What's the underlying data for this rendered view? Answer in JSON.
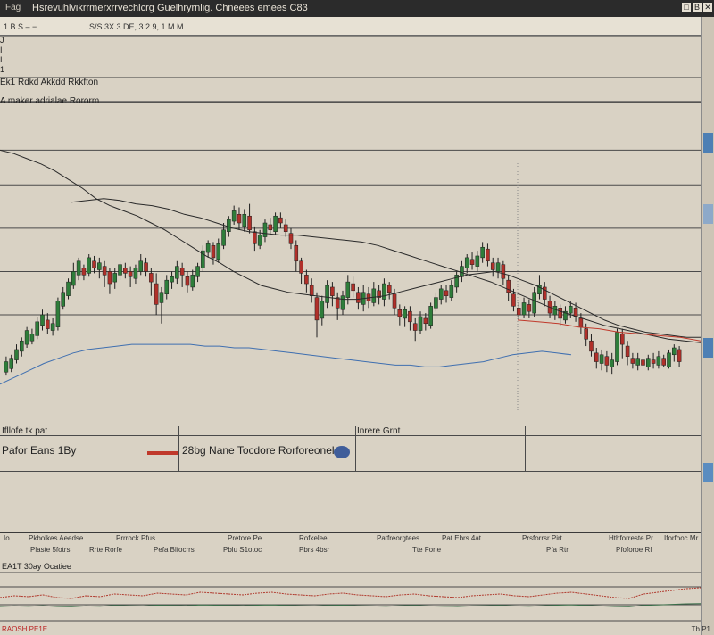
{
  "window": {
    "title": "Hsrevuhlvikrrmerxrrvechlcrg Guelhryrnlig. Chneees emees C83",
    "icon_label": "Fag",
    "buttons": [
      "□",
      "B",
      "✕"
    ]
  },
  "subbar": {
    "label": "1 B S – −",
    "info": "S/S 3X 3 DE, 3 2 9, 1 M M"
  },
  "side_markers": [
    "J",
    "I",
    "I",
    "1"
  ],
  "pane1": {
    "header": "Ek1 Rdkd Akkdd Rkkfton"
  },
  "pane2": {
    "header": "A maker adrialae Rororm"
  },
  "chart_data": {
    "type": "candlestick",
    "candles": [
      [
        22,
        28,
        31,
        20
      ],
      [
        24,
        30,
        32,
        22
      ],
      [
        29,
        35,
        38,
        27
      ],
      [
        34,
        40,
        42,
        31
      ],
      [
        38,
        46,
        48,
        36
      ],
      [
        40,
        44,
        47,
        38
      ],
      [
        43,
        51,
        54,
        41
      ],
      [
        49,
        55,
        58,
        46
      ],
      [
        52,
        47,
        56,
        44
      ],
      [
        46,
        50,
        53,
        43
      ],
      [
        48,
        63,
        65,
        46
      ],
      [
        60,
        68,
        71,
        58
      ],
      [
        66,
        74,
        76,
        64
      ],
      [
        72,
        80,
        85,
        70
      ],
      [
        78,
        86,
        88,
        75
      ],
      [
        82,
        78,
        84,
        75
      ],
      [
        79,
        88,
        90,
        77
      ],
      [
        86,
        82,
        89,
        79
      ],
      [
        81,
        85,
        88,
        76
      ],
      [
        83,
        78,
        86,
        71
      ],
      [
        80,
        73,
        82,
        67
      ],
      [
        74,
        79,
        82,
        70
      ],
      [
        78,
        84,
        86,
        75
      ],
      [
        82,
        79,
        85,
        76
      ],
      [
        80,
        77,
        83,
        71
      ],
      [
        76,
        82,
        84,
        73
      ],
      [
        80,
        86,
        90,
        78
      ],
      [
        85,
        80,
        88,
        77
      ],
      [
        79,
        74,
        82,
        66
      ],
      [
        73,
        61,
        79,
        55
      ],
      [
        62,
        68,
        71,
        50
      ],
      [
        67,
        75,
        78,
        64
      ],
      [
        74,
        77,
        80,
        70
      ],
      [
        76,
        83,
        86,
        73
      ],
      [
        82,
        78,
        85,
        71
      ],
      [
        77,
        72,
        80,
        68
      ],
      [
        71,
        78,
        81,
        69
      ],
      [
        77,
        83,
        85,
        74
      ],
      [
        82,
        92,
        95,
        80
      ],
      [
        91,
        96,
        98,
        88
      ],
      [
        95,
        88,
        97,
        84
      ],
      [
        87,
        96,
        99,
        85
      ],
      [
        95,
        104,
        108,
        93
      ],
      [
        103,
        110,
        112,
        100
      ],
      [
        109,
        115,
        118,
        107
      ],
      [
        113,
        108,
        117,
        104
      ],
      [
        106,
        113,
        116,
        103
      ],
      [
        112,
        104,
        119,
        102
      ],
      [
        103,
        96,
        106,
        92
      ],
      [
        95,
        101,
        104,
        93
      ],
      [
        100,
        108,
        110,
        97
      ],
      [
        107,
        104,
        111,
        101
      ],
      [
        103,
        112,
        114,
        101
      ],
      [
        111,
        108,
        114,
        105
      ],
      [
        107,
        103,
        110,
        100
      ],
      [
        102,
        96,
        105,
        93
      ],
      [
        95,
        86,
        98,
        80
      ],
      [
        86,
        79,
        88,
        73
      ],
      [
        78,
        73,
        81,
        68
      ],
      [
        72,
        66,
        76,
        62
      ],
      [
        65,
        52,
        68,
        42
      ],
      [
        53,
        63,
        66,
        49
      ],
      [
        62,
        72,
        75,
        59
      ],
      [
        71,
        66,
        74,
        60
      ],
      [
        65,
        59,
        68,
        52
      ],
      [
        58,
        66,
        69,
        55
      ],
      [
        65,
        74,
        78,
        61
      ],
      [
        73,
        69,
        77,
        65
      ],
      [
        68,
        62,
        71,
        58
      ],
      [
        61,
        68,
        72,
        57
      ],
      [
        67,
        63,
        71,
        59
      ],
      [
        62,
        70,
        74,
        60
      ],
      [
        69,
        65,
        72,
        61
      ],
      [
        64,
        73,
        76,
        60
      ],
      [
        72,
        68,
        74,
        64
      ],
      [
        67,
        59,
        70,
        55
      ],
      [
        58,
        54,
        61,
        49
      ],
      [
        53,
        58,
        60,
        48
      ],
      [
        57,
        51,
        60,
        46
      ],
      [
        50,
        46,
        53,
        40
      ],
      [
        46,
        54,
        57,
        44
      ],
      [
        53,
        50,
        56,
        46
      ],
      [
        49,
        60,
        62,
        47
      ],
      [
        59,
        65,
        68,
        57
      ],
      [
        64,
        70,
        72,
        61
      ],
      [
        69,
        66,
        72,
        62
      ],
      [
        65,
        72,
        75,
        63
      ],
      [
        71,
        78,
        80,
        68
      ],
      [
        77,
        83,
        86,
        74
      ],
      [
        82,
        88,
        90,
        79
      ],
      [
        87,
        84,
        91,
        81
      ],
      [
        83,
        89,
        92,
        80
      ],
      [
        88,
        94,
        97,
        85
      ],
      [
        93,
        86,
        96,
        83
      ],
      [
        85,
        81,
        88,
        77
      ],
      [
        80,
        85,
        88,
        76
      ],
      [
        84,
        76,
        86,
        72
      ],
      [
        75,
        68,
        78,
        63
      ],
      [
        67,
        60,
        70,
        57
      ],
      [
        59,
        55,
        62,
        52
      ],
      [
        55,
        62,
        65,
        53
      ],
      [
        61,
        57,
        64,
        53
      ],
      [
        56,
        68,
        71,
        54
      ],
      [
        67,
        72,
        78,
        64
      ],
      [
        71,
        64,
        74,
        60
      ],
      [
        63,
        56,
        66,
        53
      ],
      [
        55,
        60,
        63,
        52
      ],
      [
        59,
        53,
        61,
        49
      ],
      [
        52,
        57,
        60,
        50
      ],
      [
        56,
        60,
        63,
        53
      ],
      [
        59,
        54,
        62,
        51
      ],
      [
        53,
        48,
        56,
        44
      ],
      [
        47,
        41,
        50,
        37
      ],
      [
        40,
        34,
        44,
        31
      ],
      [
        33,
        28,
        36,
        24
      ],
      [
        27,
        32,
        35,
        23
      ],
      [
        31,
        26,
        34,
        22
      ],
      [
        25,
        29,
        33,
        21
      ],
      [
        28,
        45,
        47,
        26
      ],
      [
        44,
        38,
        47,
        30
      ],
      [
        37,
        31,
        40,
        26
      ],
      [
        30,
        27,
        33,
        24
      ],
      [
        26,
        30,
        33,
        23
      ],
      [
        29,
        26,
        31,
        22
      ],
      [
        25,
        30,
        32,
        23
      ],
      [
        29,
        27,
        33,
        24
      ],
      [
        26,
        31,
        34,
        24
      ],
      [
        30,
        26,
        32,
        25
      ],
      [
        25,
        33,
        35,
        24
      ],
      [
        32,
        36,
        38,
        28
      ],
      [
        35,
        28,
        37,
        25
      ]
    ],
    "moving_averages": [
      {
        "name": "",
        "color": "#2a2a2a",
        "values": [
          150,
          148,
          145,
          142,
          138,
          133,
          128,
          122,
          118,
          115,
          112,
          108,
          104,
          99,
          94,
          89,
          85,
          80,
          76,
          72,
          70,
          68,
          67,
          66,
          65,
          64,
          64,
          65,
          66,
          68,
          70,
          72,
          74,
          76,
          78,
          79,
          80,
          78,
          75,
          72,
          68,
          64,
          60,
          56,
          52,
          49,
          47,
          45,
          44,
          43,
          42,
          42
        ]
      },
      {
        "name": "",
        "color": "#2a2a2a",
        "values": [
          120,
          121,
          122,
          121,
          119,
          118,
          116,
          113,
          111,
          108,
          105,
          103,
          102,
          101,
          101,
          100,
          99,
          98,
          97,
          95,
          92,
          89,
          86,
          83,
          80,
          77,
          74,
          70,
          66,
          62,
          58,
          55,
          52,
          49,
          47,
          45,
          43,
          41,
          40,
          39
        ]
      },
      {
        "name": "",
        "color": "#3f6fb0",
        "values": [
          15,
          19,
          23,
          27,
          30,
          33,
          35,
          36,
          37,
          38,
          38,
          38,
          38,
          38,
          37,
          37,
          36,
          36,
          35,
          34,
          33,
          32,
          31,
          30,
          29,
          28,
          27,
          26,
          26,
          25,
          25,
          26,
          27,
          28,
          30,
          32,
          33,
          34,
          33,
          32
        ]
      },
      {
        "name": "",
        "color": "#c0392b",
        "values": [
          52,
          51,
          50,
          48,
          47,
          45,
          44,
          43,
          42,
          40
        ]
      }
    ],
    "price_levels": [
      55,
      80,
      105,
      130,
      150,
      178
    ],
    "ylim": [
      0,
      180
    ]
  },
  "lower_panel": {
    "left_label": "Ifllofe tk pat",
    "mid_label": "Inrere Grnt",
    "row_left": "Pafor Eans 1By",
    "row_mid": "28bg Nane Tocdore Rorforeonelaz"
  },
  "bottom_bar": {
    "items": [
      "Io",
      "Pkbolkes Aeedse",
      "Prrrock Pfus",
      "Pretore Pe",
      "Rofkelee",
      "Patfreorgtees",
      "Pat Ebrs 4at",
      "Prsforrsr Pirt",
      "Hthforreste Pr",
      "Iforfooc Mr",
      "Plaste 5fotrs",
      "Rrte Rorfe",
      "Pefa Blfocrrs",
      "Pblu S1otoc",
      "Pbrs 4bsr",
      "Tte Fone",
      "Pfa Rtr",
      "Pfoforoe Rf"
    ]
  },
  "oscillator": {
    "header": "EA1T 30ay Ocatiee",
    "values": [
      20,
      22,
      21,
      23,
      20,
      19,
      22,
      21,
      24,
      23,
      22,
      25,
      24,
      23,
      26,
      25,
      24,
      23,
      25,
      26,
      24,
      23,
      22,
      24,
      25,
      23,
      22,
      21,
      23,
      24,
      22,
      21,
      20,
      22,
      23,
      24,
      22,
      21,
      23,
      25,
      26,
      24,
      22,
      20,
      19,
      24,
      26,
      28,
      30,
      31
    ]
  },
  "footer": {
    "left": "RAOSH PE1E",
    "right": "Tb P1"
  }
}
